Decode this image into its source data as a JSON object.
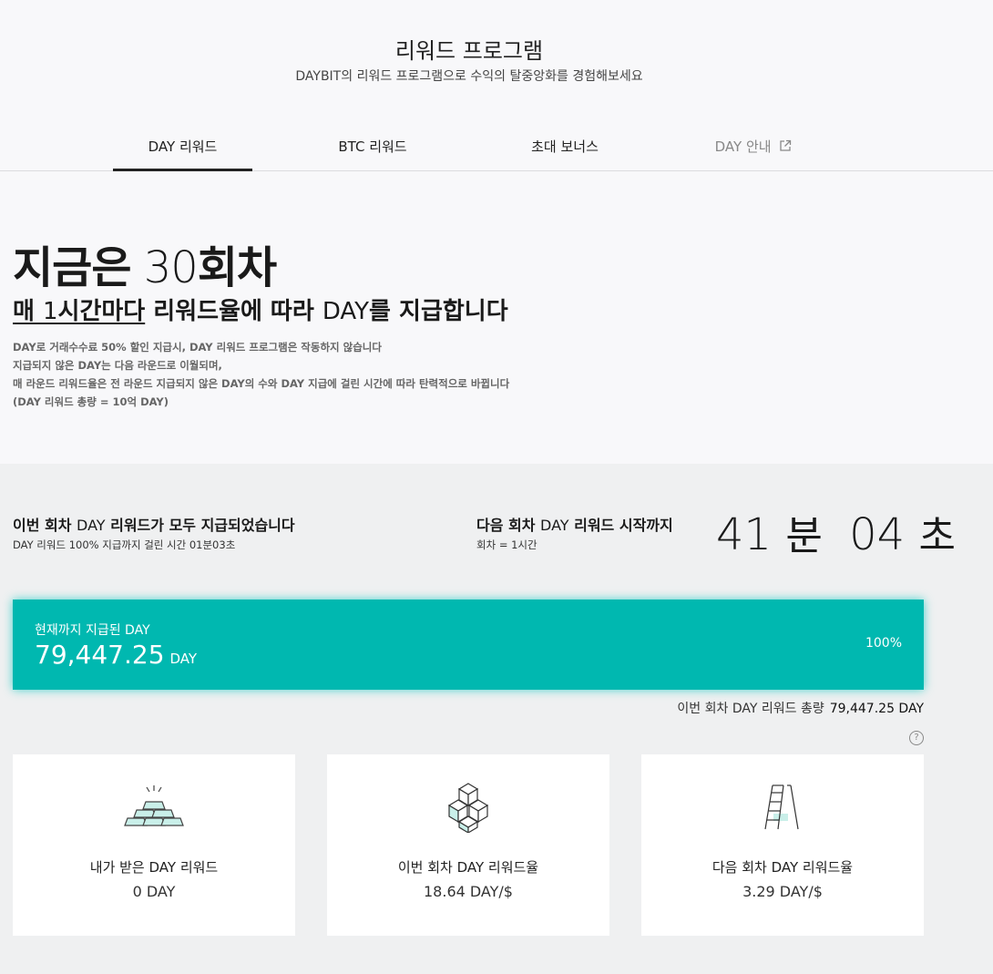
{
  "header": {
    "title": "리워드 프로그램",
    "subtitle": "DAYBIT의 리워드 프로그램으로 수익의 탈중앙화를 경험해보세요"
  },
  "tabs": [
    {
      "label": "DAY 리워드",
      "active": true
    },
    {
      "label": "BTC 리워드",
      "active": false
    },
    {
      "label": "초대 보너스",
      "active": false
    },
    {
      "label": "DAY 안내",
      "active": false,
      "external": true
    }
  ],
  "hero": {
    "title_prefix": "지금은",
    "round": "30",
    "title_suffix": "회차",
    "sub_underlined_prefix": "매 ",
    "sub_underlined_num": "1",
    "sub_underlined_suffix": "시간마다",
    "sub_mid": " 리워드율에 따라 ",
    "sub_day": "DAY",
    "sub_end": "를 지급합니다",
    "notes": [
      "DAY로 거래수수료 50% 할인 지급시, DAY 리워드 프로그램은 작동하지 않습니다",
      "지급되지 않은 DAY는 다음 라운드로 이월되며,",
      "매 라운드 리워드율은 전 라운드 지급되지 않은 DAY의 수와 DAY 지급에 걸린 시간에 따라 탄력적으로 바뀝니다",
      "(DAY 리워드 총량 = 10억 DAY)"
    ]
  },
  "status": {
    "left_title_pre": "이번 회차 ",
    "left_title_day": "DAY",
    "left_title_post": " 리워드가 모두 지급되었습니다",
    "left_sub": "DAY 리워드 100% 지급까지 걸린 시간 01분03초",
    "right_title_pre": "다음 회차 ",
    "right_title_day": "DAY",
    "right_title_post": " 리워드 시작까지",
    "right_sub": "회차 = 1시간",
    "countdown_min": "41",
    "countdown_min_unit": "분",
    "countdown_sec": "04",
    "countdown_sec_unit": "초"
  },
  "progress": {
    "label": "현재까지 지급된 DAY",
    "amount": "79,447.25",
    "unit": "DAY",
    "percent_label": "100%",
    "fraction": 1.0,
    "color": "#00b8b0"
  },
  "total": {
    "label": "이번 회차 DAY 리워드 총량",
    "value": "79,447.25 DAY"
  },
  "cards": [
    {
      "label": "내가 받은 DAY 리워드",
      "value": "0 DAY",
      "icon": "gold-bars-icon"
    },
    {
      "label": "이번 회차 DAY 리워드율",
      "value": "18.64 DAY/$",
      "icon": "cubes-icon"
    },
    {
      "label": "다음 회차 DAY 리워드율",
      "value": "3.29 DAY/$",
      "icon": "ladder-icon"
    }
  ]
}
